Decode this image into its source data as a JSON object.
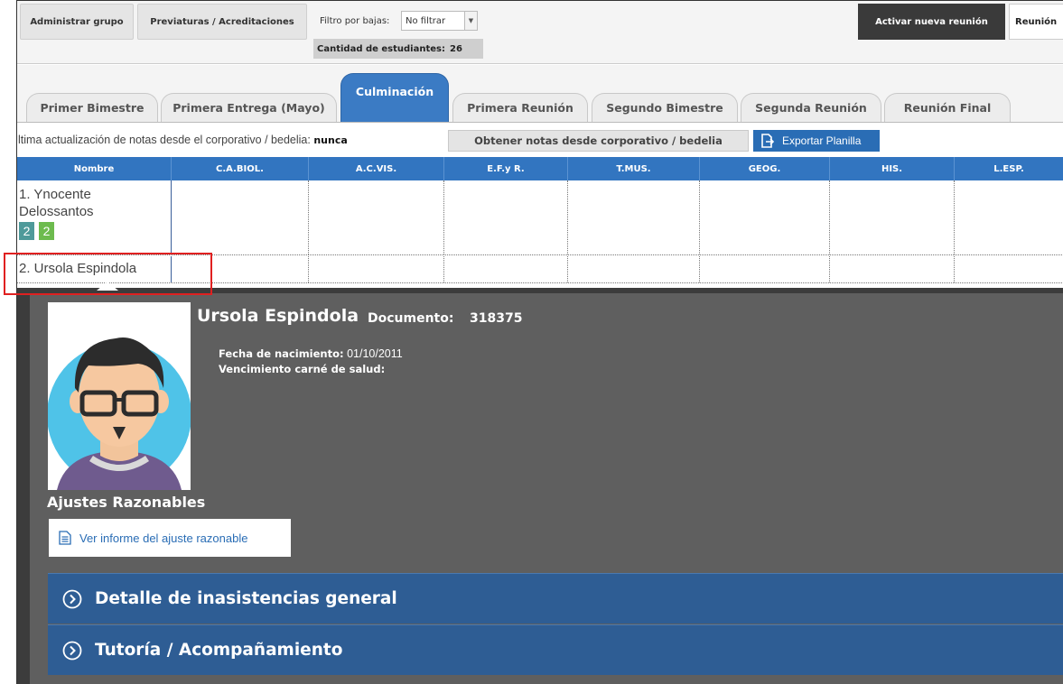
{
  "toolbar": {
    "admin_group": "Administrar grupo",
    "previaturas": "Previaturas / Acreditaciones",
    "filter_label": "Filtro por bajas:",
    "filter_value": "No filtrar",
    "count_label": "Cantidad de estudiantes:",
    "count_value": "26",
    "activate_meeting": "Activar nueva reunión",
    "meeting": "Reunión"
  },
  "tabs": [
    {
      "label": "Primer Bimestre"
    },
    {
      "label": "Primera Entrega (Mayo)"
    },
    {
      "label": "Culminación"
    },
    {
      "label": "Primera Reunión"
    },
    {
      "label": "Segundo Bimestre"
    },
    {
      "label": "Segunda Reunión"
    },
    {
      "label": "Reunión Final"
    }
  ],
  "active_tab": "Culminación",
  "info": {
    "last_update_label": "Última actualización de notas desde el corporativo / bedelia:",
    "last_update_value": "nunca",
    "fetch_button": "Obtener notas desde corporativo / bedelia",
    "export_button": "Exportar Planilla"
  },
  "table": {
    "columns": [
      "Nombre",
      "C.A.BIOL.",
      "A.C.VIS.",
      "E.F.y R.",
      "T.MUS.",
      "GEOG.",
      "HIS.",
      "L.ESP."
    ],
    "rows": [
      {
        "name_line1": "1. Ynocente",
        "name_line2": "Delossantos",
        "badges": [
          "2",
          "2"
        ]
      },
      {
        "name_line1": "2. Ursola Espindola"
      }
    ]
  },
  "student": {
    "name": "Ursola Espindola",
    "document_label": "Documento:",
    "document_value": "318375",
    "birth_label": "Fecha de nacimiento:",
    "birth_value": "01/10/2011",
    "health_label": "Vencimiento carné de salud:",
    "health_value": ""
  },
  "ajustes": {
    "title": "Ajustes Razonables",
    "link": "Ver informe del ajuste razonable"
  },
  "sections": [
    {
      "label": "Detalle de inasistencias general"
    },
    {
      "label": "Tutoría / Acompañamiento"
    }
  ],
  "colors": {
    "accent": "#3275c0",
    "tab_active": "#3b7bc4",
    "section": "#2e5d94",
    "panel": "#5f5f5f",
    "badge_teal": "#4e9a9a",
    "badge_green": "#6dbb4e",
    "highlight": "#e02020"
  },
  "icons": {
    "export": "export-icon",
    "document": "document-icon",
    "chevron": "chevron-circle-icon",
    "dropdown": "chevron-down-icon"
  }
}
